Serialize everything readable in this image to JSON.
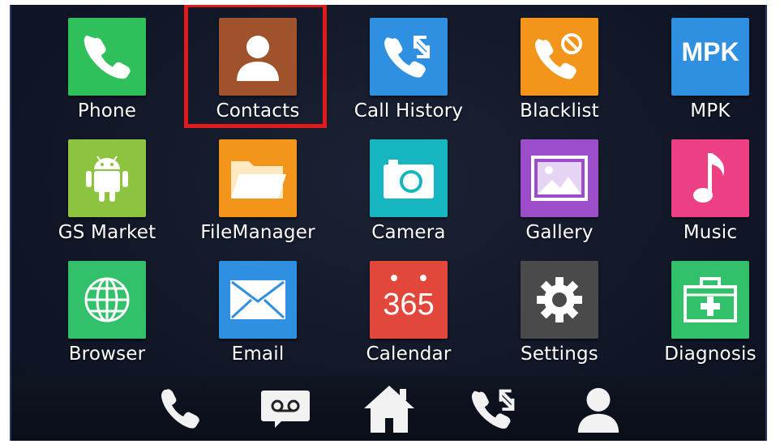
{
  "apps": [
    {
      "id": "phone",
      "label": "Phone",
      "icon": "phone-icon",
      "color": "#2fbf5b"
    },
    {
      "id": "contacts",
      "label": "Contacts",
      "icon": "contact-person-icon",
      "color": "#a0522d"
    },
    {
      "id": "call-history",
      "label": "Call History",
      "icon": "call-history-icon",
      "color": "#2f8fe0"
    },
    {
      "id": "blacklist",
      "label": "Blacklist",
      "icon": "blacklist-icon",
      "color": "#f2951a"
    },
    {
      "id": "mpk",
      "label": "MPK",
      "icon_text": "MPK",
      "icon": "mpk-icon",
      "color": "#2f8fe0"
    },
    {
      "id": "gs-market",
      "label": "GS Market",
      "icon": "android-icon",
      "color": "#8cc33f"
    },
    {
      "id": "file-manager",
      "label": "FileManager",
      "icon": "folder-icon",
      "color": "#f2951a"
    },
    {
      "id": "camera",
      "label": "Camera",
      "icon": "camera-icon",
      "color": "#16b6c1"
    },
    {
      "id": "gallery",
      "label": "Gallery",
      "icon": "picture-icon",
      "color": "#9b4dca"
    },
    {
      "id": "music",
      "label": "Music",
      "icon": "music-note-icon",
      "color": "#ec3f84"
    },
    {
      "id": "browser",
      "label": "Browser",
      "icon": "globe-icon",
      "color": "#33c06a"
    },
    {
      "id": "email",
      "label": "Email",
      "icon": "envelope-icon",
      "color": "#2f8fe0"
    },
    {
      "id": "calendar",
      "label": "Calendar",
      "icon_text": "365",
      "icon": "calendar-icon",
      "color": "#e2473b"
    },
    {
      "id": "settings",
      "label": "Settings",
      "icon": "gear-icon",
      "color": "#4a4a4a"
    },
    {
      "id": "diagnosis",
      "label": "Diagnosis",
      "icon": "first-aid-kit-icon",
      "color": "#33c06a"
    }
  ],
  "dock": [
    "phone-icon",
    "voicemail-icon",
    "home-icon",
    "call-history-icon",
    "contact-person-icon"
  ]
}
